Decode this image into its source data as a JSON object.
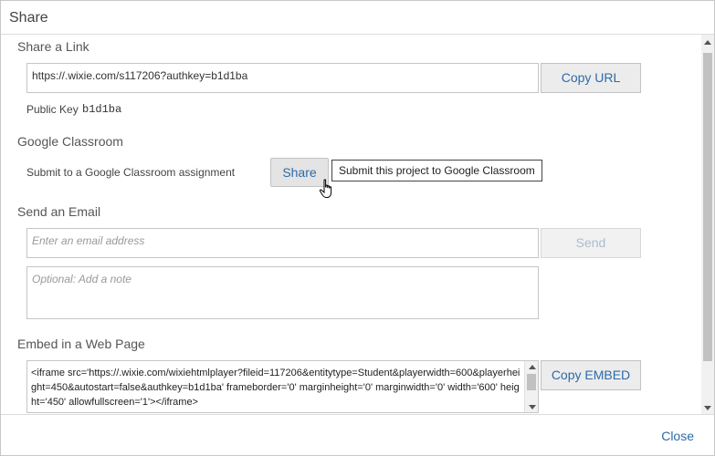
{
  "dialog": {
    "title": "Share",
    "close_label": "Close"
  },
  "share_link": {
    "section_title": "Share a Link",
    "url": "https://.wixie.com/s117206?authkey=b1d1ba",
    "copy_button": "Copy URL",
    "public_key_label": "Public Key",
    "public_key_value": "b1d1ba"
  },
  "google_classroom": {
    "section_title": "Google Classroom",
    "description": "Submit to a Google Classroom assignment",
    "share_button": "Share",
    "tooltip": "Submit this project to Google Classroom"
  },
  "email": {
    "section_title": "Send an Email",
    "email_placeholder": "Enter an email address",
    "note_placeholder": "Optional: Add a note",
    "send_button": "Send"
  },
  "embed": {
    "section_title": "Embed in a Web Page",
    "code": "<iframe src='https://.wixie.com/wixiehtmlplayer?fileid=117206&entitytype=Student&playerwidth=600&playerheight=450&autostart=false&authkey=b1d1ba' frameborder='0' marginheight='0' marginwidth='0' width='600' height='450' allowfullscreen='1'></iframe>",
    "copy_button": "Copy EMBED"
  },
  "colors": {
    "link_blue": "#2d6aa8",
    "button_bg": "#ececec",
    "border": "#c6c6c6"
  }
}
